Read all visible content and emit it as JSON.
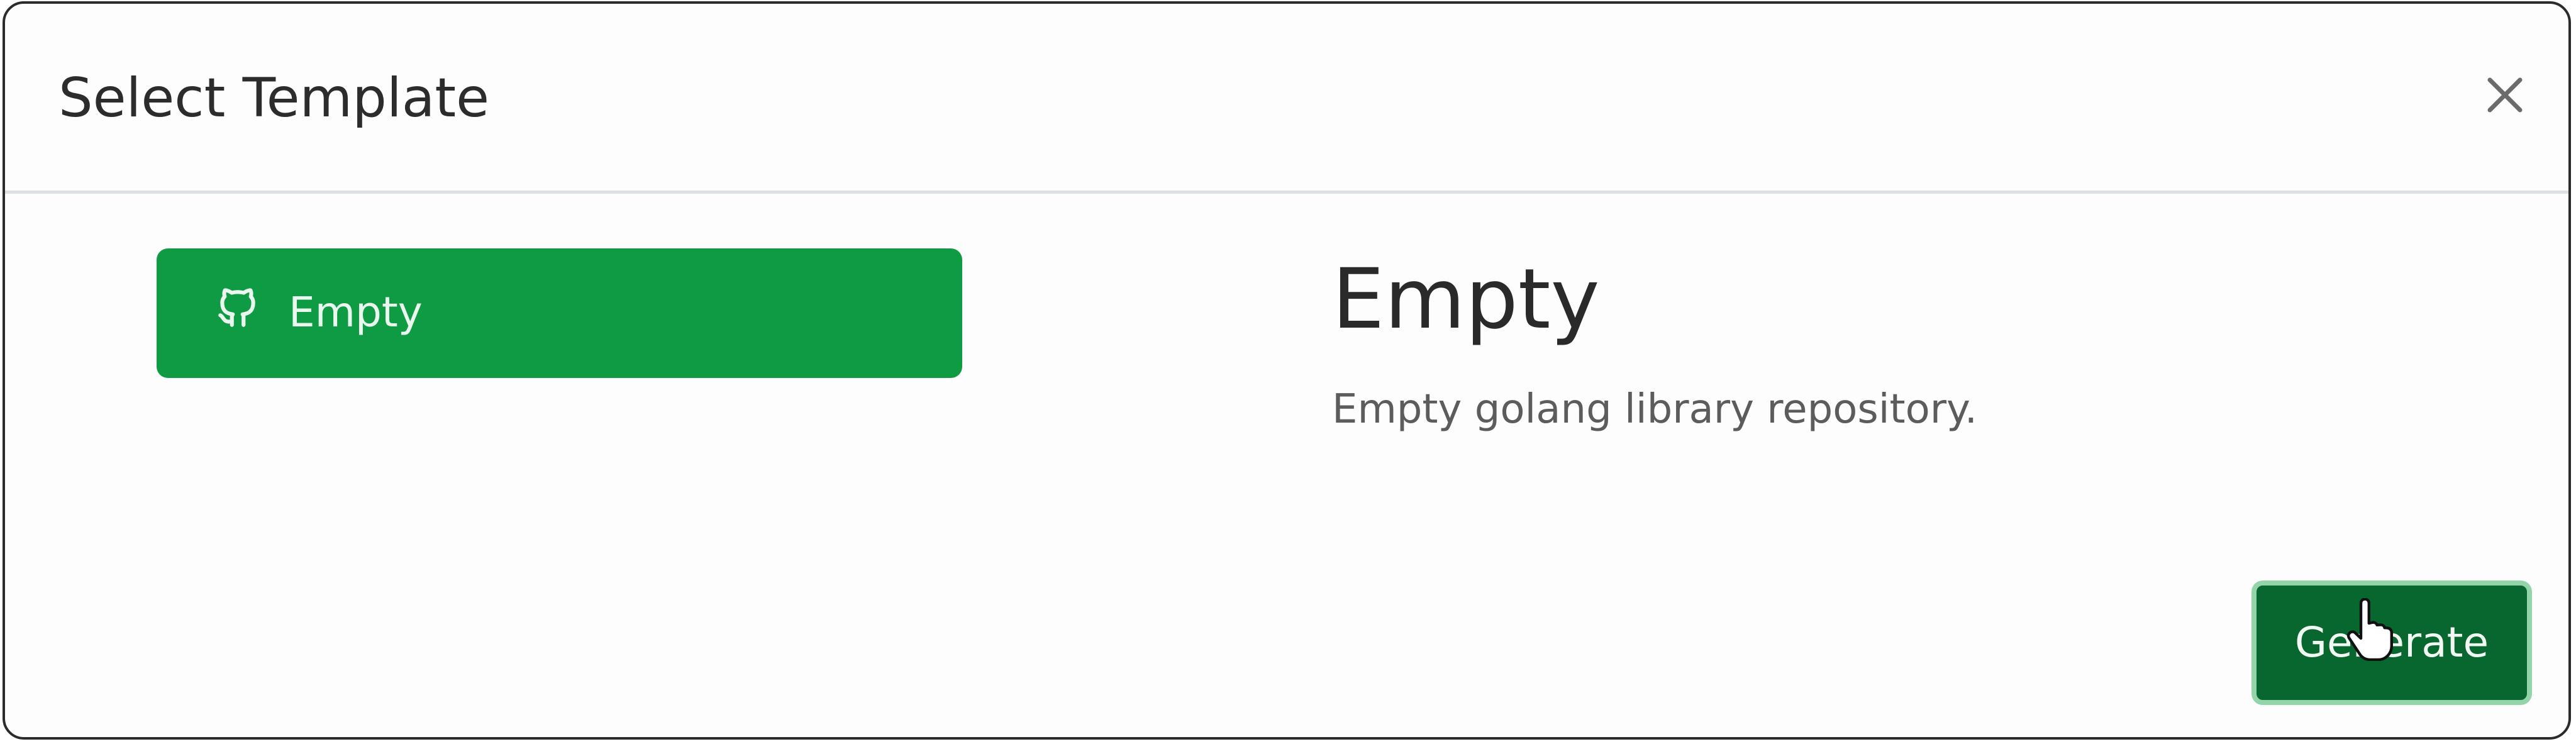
{
  "modal": {
    "title": "Select Template",
    "close_icon": "close-icon"
  },
  "templates": [
    {
      "label": "Empty",
      "icon": "github-icon",
      "selected": true
    }
  ],
  "detail": {
    "title": "Empty",
    "description": "Empty golang library repository."
  },
  "actions": {
    "generate_label": "Generate"
  },
  "colors": {
    "selected_item": "#0f9b43",
    "generate_button": "#08672e",
    "generate_border": "#93d5a9"
  }
}
